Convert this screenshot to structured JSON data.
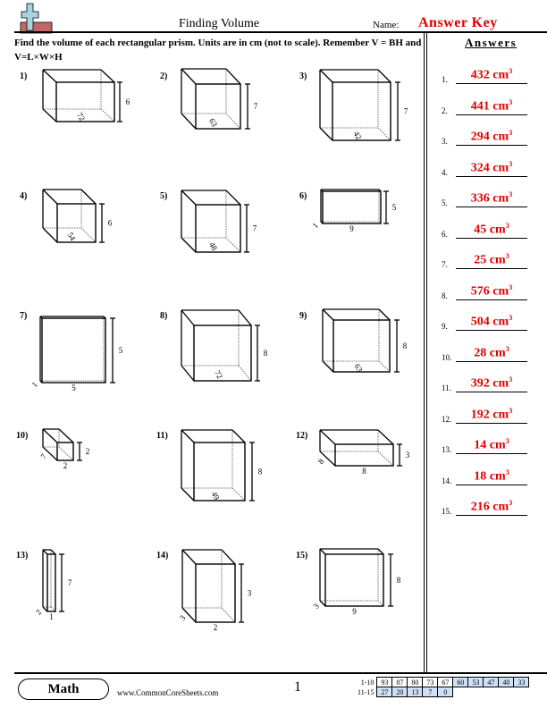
{
  "header": {
    "title": "Finding Volume",
    "name_label": "Name:",
    "answer_key": "Answer Key",
    "logo_icon": "plus-minus-logo-icon",
    "instructions": "Find the volume of each rectangular prism. Units are in cm (not to scale). Remember V = BH and V=L×W×H"
  },
  "problems": [
    {
      "label": "1)",
      "height": "6",
      "base": "72"
    },
    {
      "label": "2)",
      "height": "7",
      "base": "63"
    },
    {
      "label": "3)",
      "height": "7",
      "base": "42"
    },
    {
      "label": "4)",
      "height": "6",
      "base": "54"
    },
    {
      "label": "5)",
      "height": "7",
      "base": "48"
    },
    {
      "label": "6)",
      "height": "5",
      "length": "9",
      "width": "1"
    },
    {
      "label": "7)",
      "height": "5",
      "length": "5",
      "width": "1"
    },
    {
      "label": "8)",
      "height": "8",
      "base": "72"
    },
    {
      "label": "9)",
      "height": "8",
      "base": "63"
    },
    {
      "label": "10)",
      "height": "2",
      "length": "2",
      "width": "7"
    },
    {
      "label": "11)",
      "height": "8",
      "base": "49"
    },
    {
      "label": "12)",
      "height": "3",
      "length": "8",
      "width": "8"
    },
    {
      "label": "13)",
      "height": "7",
      "length": "1",
      "width": "2"
    },
    {
      "label": "14)",
      "height": "3",
      "length": "2",
      "width": "3"
    },
    {
      "label": "15)",
      "height": "8",
      "length": "9",
      "width": "3"
    }
  ],
  "answers": {
    "heading": "Answers",
    "unit_exp": "3",
    "items": [
      {
        "num": "1.",
        "value": "432 cm"
      },
      {
        "num": "2.",
        "value": "441 cm"
      },
      {
        "num": "3.",
        "value": "294 cm"
      },
      {
        "num": "4.",
        "value": "324 cm"
      },
      {
        "num": "5.",
        "value": "336 cm"
      },
      {
        "num": "6.",
        "value": "45 cm"
      },
      {
        "num": "7.",
        "value": "25 cm"
      },
      {
        "num": "8.",
        "value": "576 cm"
      },
      {
        "num": "9.",
        "value": "504 cm"
      },
      {
        "num": "10.",
        "value": "28 cm"
      },
      {
        "num": "11.",
        "value": "392 cm"
      },
      {
        "num": "12.",
        "value": "192 cm"
      },
      {
        "num": "13.",
        "value": "14 cm"
      },
      {
        "num": "14.",
        "value": "18 cm"
      },
      {
        "num": "15.",
        "value": "216 cm"
      }
    ]
  },
  "footer": {
    "subject": "Math",
    "website": "www.CommonCoreSheets.com",
    "page": "1",
    "score_rows": [
      {
        "label": "1-10",
        "scores": [
          "93",
          "87",
          "80",
          "73",
          "67",
          "60",
          "53",
          "47",
          "40",
          "33"
        ]
      },
      {
        "label": "11-15",
        "scores": [
          "27",
          "20",
          "13",
          "7",
          "0"
        ]
      }
    ]
  },
  "colors": {
    "answer": "#e00000",
    "score_highlight": "#cfe0f7",
    "logo_blue": "#a8d4e0",
    "logo_red": "#c06868"
  }
}
